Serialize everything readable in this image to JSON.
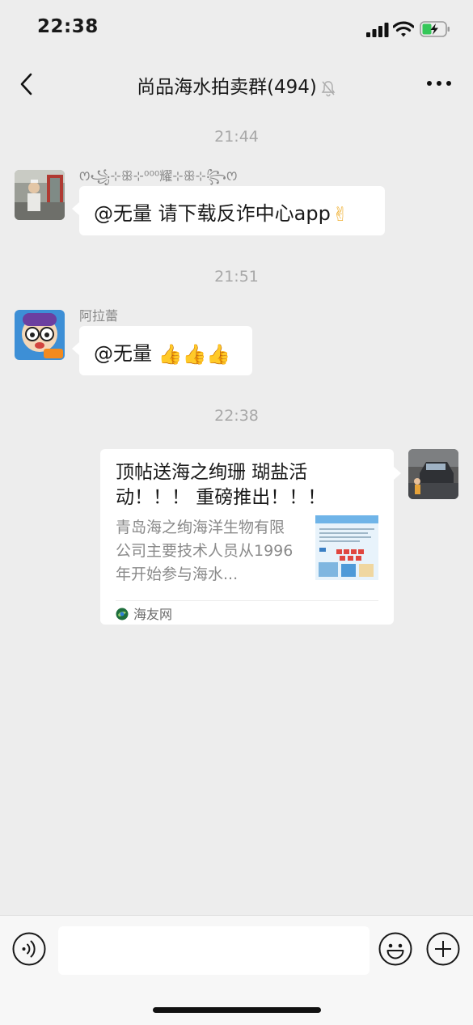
{
  "status": {
    "time": "22:38"
  },
  "nav": {
    "title": "尚品海水拍卖群(494)"
  },
  "messages": [
    {
      "timestamp": "21:44",
      "sender": "ꯁ꧁⊹ꕥ⊹⁰⁰⁰耀⊹ꕥ⊹꧂ꯁ",
      "text": "@无量 请下载反诈中心app",
      "emoji": "✌"
    },
    {
      "timestamp": "21:51",
      "sender": "阿拉蕾",
      "text": "@无量 ",
      "emoji": "👍👍👍"
    },
    {
      "timestamp": "22:38",
      "sender": "",
      "card": {
        "title": "顶帖送海之绚珊 瑚盐活动！！！ 重磅推出！！！",
        "description": "青岛海之绚海洋生物有限公司主要技术人员从1996 年开始参与海水...",
        "source": "海友网"
      }
    }
  ],
  "input": {
    "placeholder": ""
  },
  "colors": {
    "background": "#ededed",
    "bubble": "#ffffff",
    "timestamp": "#a8a8a8"
  }
}
